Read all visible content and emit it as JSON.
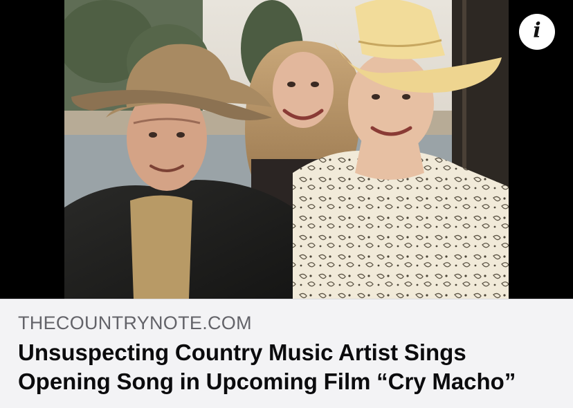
{
  "post": {
    "link_domain": "THECOUNTRYNOTE.COM",
    "headline": "Unsuspecting Country Music Artist Sings Opening Song in Upcoming Film “Cry Macho”"
  },
  "info_button": {
    "icon": "info-icon",
    "glyph": "i"
  },
  "colors": {
    "background": "#f3f3f5",
    "domain_text": "#636369",
    "headline_text": "#0b0b0d",
    "photo_letterbox": "#000000"
  }
}
